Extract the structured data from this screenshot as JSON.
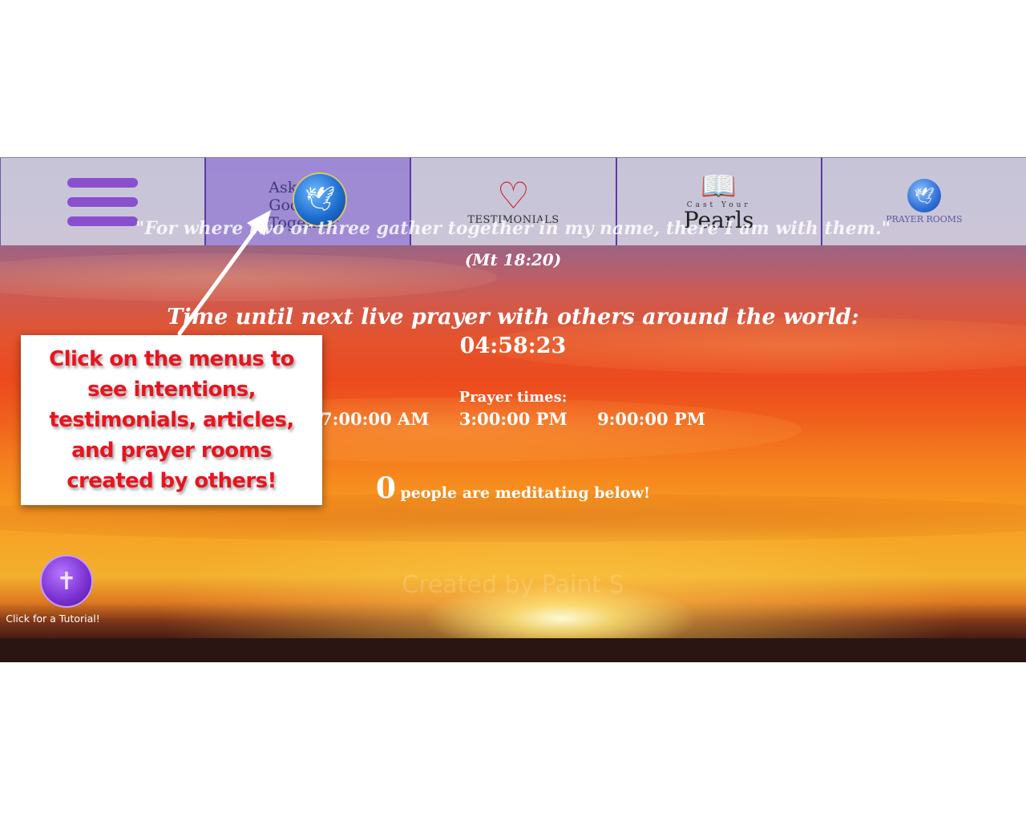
{
  "nav": {
    "items": [
      {
        "name": "menu"
      },
      {
        "label_lines": [
          "Ask",
          "God",
          "Together"
        ]
      },
      {
        "label": "TESTIMONIALS"
      },
      {
        "small": "Cast Your",
        "label": "Pearls"
      },
      {
        "label": "PRAYER ROOMS"
      }
    ]
  },
  "verse": {
    "quote": "\"For where two or three gather together in my name, there I am with them.\"",
    "reference": "(Mt 18:20)"
  },
  "countdown": {
    "label": "Time until next live prayer with others around the world:",
    "value": "04:58:23"
  },
  "prayer": {
    "label": "Prayer times:",
    "times": [
      "7:00:00 AM",
      "3:00:00 PM",
      "9:00:00 PM"
    ]
  },
  "meditating": {
    "count": "0",
    "text": "people are meditating below!"
  },
  "watermark": "Created by Paint S",
  "tutorial": {
    "label": "Click for a Tutorial!"
  },
  "callout": {
    "text": "Click on the menus to see intentions, testimonials, articles, and prayer rooms created by others!",
    "color": "#e8141f"
  },
  "colors": {
    "nav_bg": "#d0ccde",
    "nav_active": "#a08cd7",
    "hamburger": "#8a4fcf",
    "accent_border": "#5b3aa0"
  },
  "icons": [
    "hamburger-icon",
    "dove-globe-icon",
    "heart-cross-icon",
    "book-icon",
    "globe-dove-icon",
    "tutorial-cross-icon"
  ]
}
